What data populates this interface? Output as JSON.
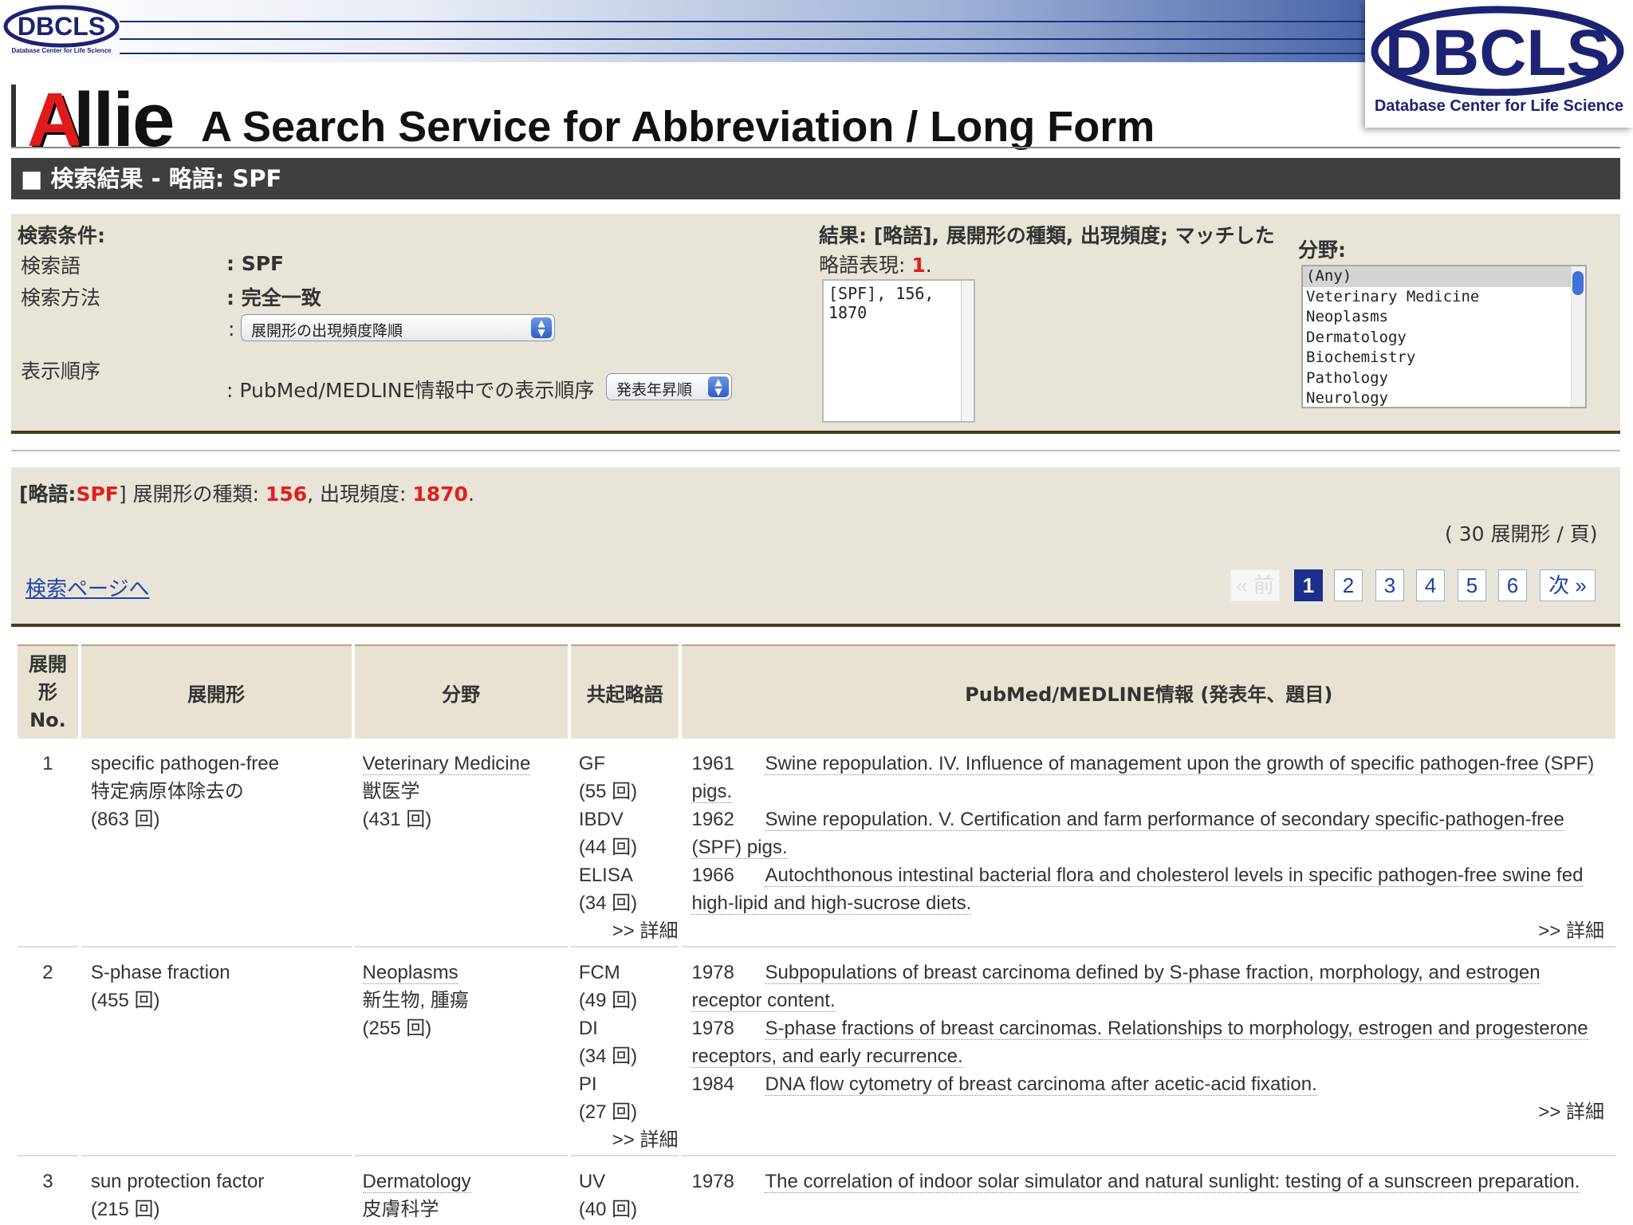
{
  "header": {
    "small_logo_text": "DBCLS",
    "small_logo_sub": "Database Center for Life Science",
    "big_logo_text": "DBCLS",
    "big_logo_sub": "Database Center for Life Science",
    "app_name_first": "A",
    "app_name_rest": "llie",
    "app_subtitle": "A Search Service for Abbreviation / Long Form",
    "result_title": "■ 検索結果 - 略語: SPF"
  },
  "search": {
    "conditions_label": "検索条件:",
    "term_label": "検索語",
    "term_value": ": SPF",
    "method_label": "検索方法",
    "method_value": ": 完全一致",
    "order_label": "表示順序",
    "colon": ":",
    "sort_select": "展開形の出現頻度降順",
    "pubmed_order_label": ": PubMed/MEDLINE情報中での表示順序",
    "pubmed_order_select": "発表年昇順"
  },
  "result_summary": {
    "label_line1": "結果: [略語], 展開形の種類, 出現頻度; マッチした",
    "label_line2": "略語表現: ",
    "match_count": "1",
    "period": ".",
    "box_item": "[SPF], 156, 1870"
  },
  "field_filter": {
    "label": "分野:",
    "options": [
      "(Any)",
      "Veterinary Medicine",
      "Neoplasms",
      "Dermatology",
      "Biochemistry",
      "Pathology",
      "Neurology"
    ],
    "selected": "(Any)"
  },
  "summary": {
    "abbr_prefix": "[略語:",
    "abbr": "SPF",
    "abbr_suffix": "] 展開形の種類: ",
    "kinds": "156",
    "freq_label": ", 出現頻度: ",
    "freq": "1870",
    "end": ".",
    "per_page": "( 30 展開形 / 頁)",
    "back_link": "検索ページへ"
  },
  "pagination": {
    "prev": "« 前",
    "pages": [
      "1",
      "2",
      "3",
      "4",
      "5",
      "6"
    ],
    "current": "1",
    "next": "次 »"
  },
  "table": {
    "headers": [
      "展開形No.",
      "展開形",
      "分野",
      "共起略語",
      "PubMed/MEDLINE情報 (発表年、題目)"
    ],
    "header_no_lines": [
      "展開",
      "形",
      "No."
    ],
    "detail_link": ">> 詳細",
    "rows": [
      {
        "no": "1",
        "long_form": "specific pathogen-free",
        "long_form_ja": "特定病原体除去の",
        "count": "(863 回)",
        "field": "Veterinary Medicine",
        "field_ja": "獣医学",
        "field_count": "(431 回)",
        "cooccur": [
          [
            "GF",
            "(55 回)"
          ],
          [
            "IBDV",
            "(44 回)"
          ],
          [
            "ELISA",
            "(34 回)"
          ]
        ],
        "pubs": [
          [
            "1961",
            "Swine repopulation. IV. Influence of management upon the growth of specific pathogen-free (SPF) pigs."
          ],
          [
            "1962",
            "Swine repopulation. V. Certification and farm performance of secondary specific-pathogen-free (SPF) pigs."
          ],
          [
            "1966",
            "Autochthonous intestinal bacterial flora and cholesterol levels in specific pathogen-free swine fed high-lipid and high-sucrose diets."
          ]
        ]
      },
      {
        "no": "2",
        "long_form": "S-phase fraction",
        "long_form_ja": "",
        "count": "(455 回)",
        "field": "Neoplasms",
        "field_ja": "新生物, 腫瘍",
        "field_count": "(255 回)",
        "cooccur": [
          [
            "FCM",
            "(49 回)"
          ],
          [
            "DI",
            "(34 回)"
          ],
          [
            "PI",
            "(27 回)"
          ]
        ],
        "pubs": [
          [
            "1978",
            "Subpopulations of breast carcinoma defined by S-phase fraction, morphology, and estrogen receptor content."
          ],
          [
            "1978",
            "S-phase fractions of breast carcinomas. Relationships to morphology, estrogen and progesterone receptors, and early recurrence."
          ],
          [
            "1984",
            "DNA flow cytometry of breast carcinoma after acetic-acid fixation."
          ]
        ]
      },
      {
        "no": "3",
        "long_form": "sun protection factor",
        "long_form_ja": "",
        "count": "(215 回)",
        "field": "Dermatology",
        "field_ja": "皮膚科学",
        "field_count": "",
        "cooccur": [
          [
            "UV",
            "(40 回)"
          ]
        ],
        "pubs": [
          [
            "1978",
            "The correlation of indoor solar simulator and natural sunlight: testing of a sunscreen preparation."
          ]
        ]
      }
    ]
  }
}
